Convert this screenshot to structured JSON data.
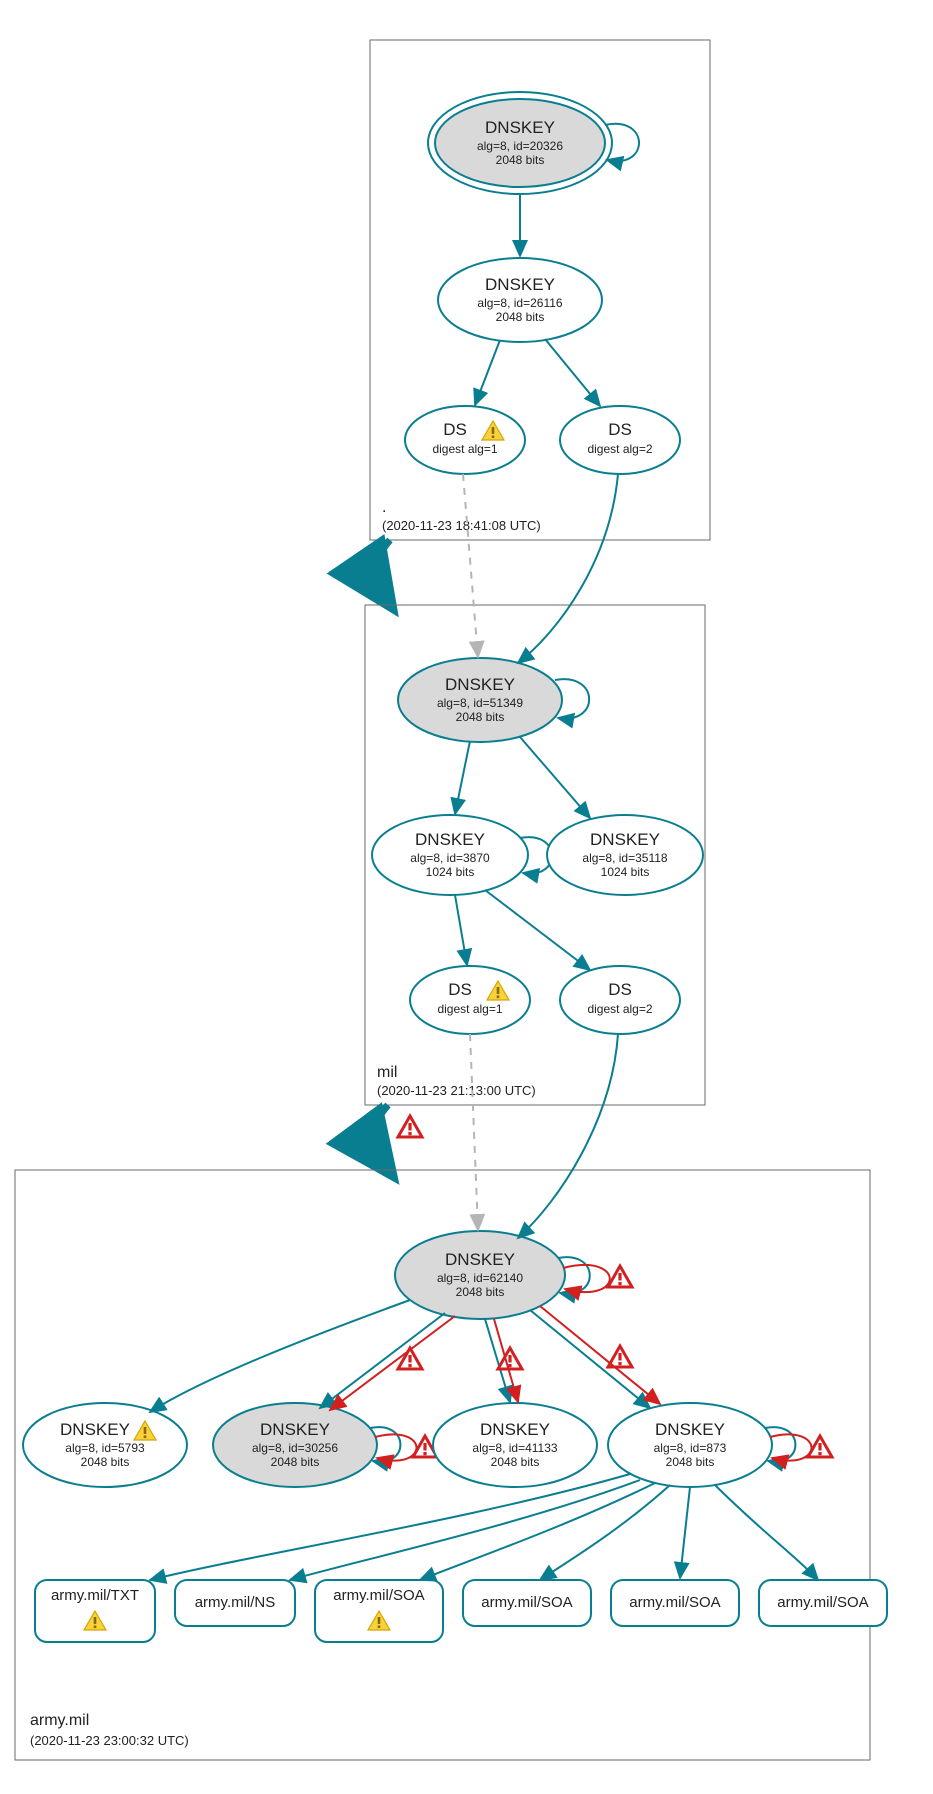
{
  "colors": {
    "teal": "#0a7e91",
    "gray": "#d9d9d9",
    "red": "#d21f1f",
    "dashed": "#b5b5b5"
  },
  "zones": {
    "root": {
      "label": ".",
      "date": "(2020-11-23 18:41:08 UTC)"
    },
    "mil": {
      "label": "mil",
      "date": "(2020-11-23 21:13:00 UTC)"
    },
    "army": {
      "label": "army.mil",
      "date": "(2020-11-23 23:00:32 UTC)"
    }
  },
  "nodes": {
    "root_ksk": {
      "type": "DNSKEY",
      "sub1": "alg=8, id=20326",
      "sub2": "2048 bits"
    },
    "root_zsk": {
      "type": "DNSKEY",
      "sub1": "alg=8, id=26116",
      "sub2": "2048 bits"
    },
    "root_ds1": {
      "type": "DS",
      "sub1": "digest alg=1"
    },
    "root_ds2": {
      "type": "DS",
      "sub1": "digest alg=2"
    },
    "mil_ksk": {
      "type": "DNSKEY",
      "sub1": "alg=8, id=51349",
      "sub2": "2048 bits"
    },
    "mil_zsk1": {
      "type": "DNSKEY",
      "sub1": "alg=8, id=3870",
      "sub2": "1024 bits"
    },
    "mil_zsk2": {
      "type": "DNSKEY",
      "sub1": "alg=8, id=35118",
      "sub2": "1024 bits"
    },
    "mil_ds1": {
      "type": "DS",
      "sub1": "digest alg=1"
    },
    "mil_ds2": {
      "type": "DS",
      "sub1": "digest alg=2"
    },
    "army_ksk": {
      "type": "DNSKEY",
      "sub1": "alg=8, id=62140",
      "sub2": "2048 bits"
    },
    "army_k1": {
      "type": "DNSKEY",
      "sub1": "alg=8, id=5793",
      "sub2": "2048 bits"
    },
    "army_k2": {
      "type": "DNSKEY",
      "sub1": "alg=8, id=30256",
      "sub2": "2048 bits"
    },
    "army_k3": {
      "type": "DNSKEY",
      "sub1": "alg=8, id=41133",
      "sub2": "2048 bits"
    },
    "army_k4": {
      "type": "DNSKEY",
      "sub1": "alg=8, id=873",
      "sub2": "2048 bits"
    }
  },
  "rr": {
    "r1": "army.mil/TXT",
    "r2": "army.mil/NS",
    "r3": "army.mil/SOA",
    "r4": "army.mil/SOA",
    "r5": "army.mil/SOA",
    "r6": "army.mil/SOA"
  }
}
